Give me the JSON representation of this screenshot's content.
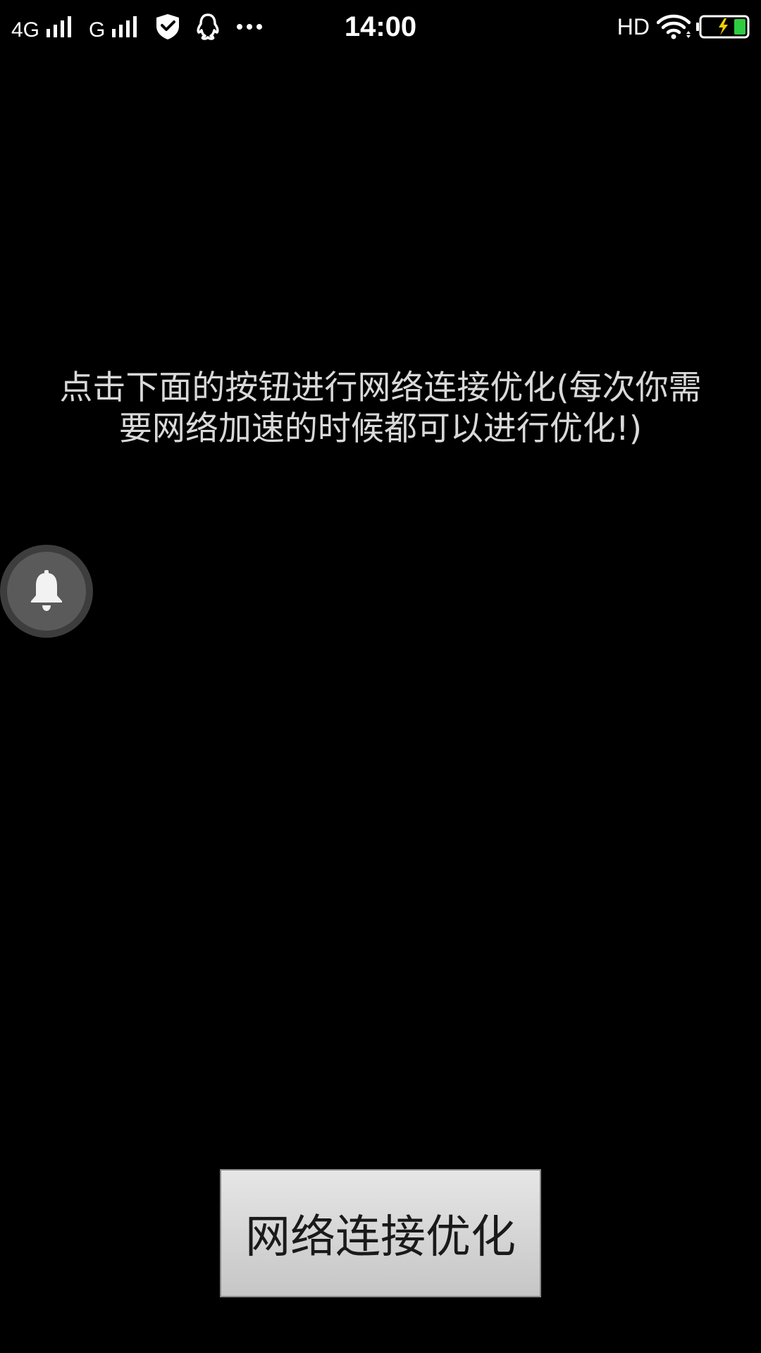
{
  "status_bar": {
    "network_1": "4G",
    "network_2": "G",
    "time": "14:00",
    "hd_label": "HD",
    "icons": [
      "signal-icon",
      "signal-icon",
      "shield-icon",
      "qq-icon",
      "more-dots-icon",
      "wifi-icon",
      "battery-charging-icon"
    ],
    "battery_level_percent": 100
  },
  "main": {
    "instruction_text": "点击下面的按钮进行网络连接优化(每次你需\n要网络加速的时候都可以进行优化!)",
    "optimize_button_label": "网络连接优化"
  },
  "floating_button": {
    "icon": "bell-icon"
  },
  "colors": {
    "background": "#000000",
    "instruction_text": "#d9d9d9",
    "button_bg": "#d6d6d6",
    "battery_fill": "#2ecc40",
    "charge_bolt": "#f5d000"
  }
}
